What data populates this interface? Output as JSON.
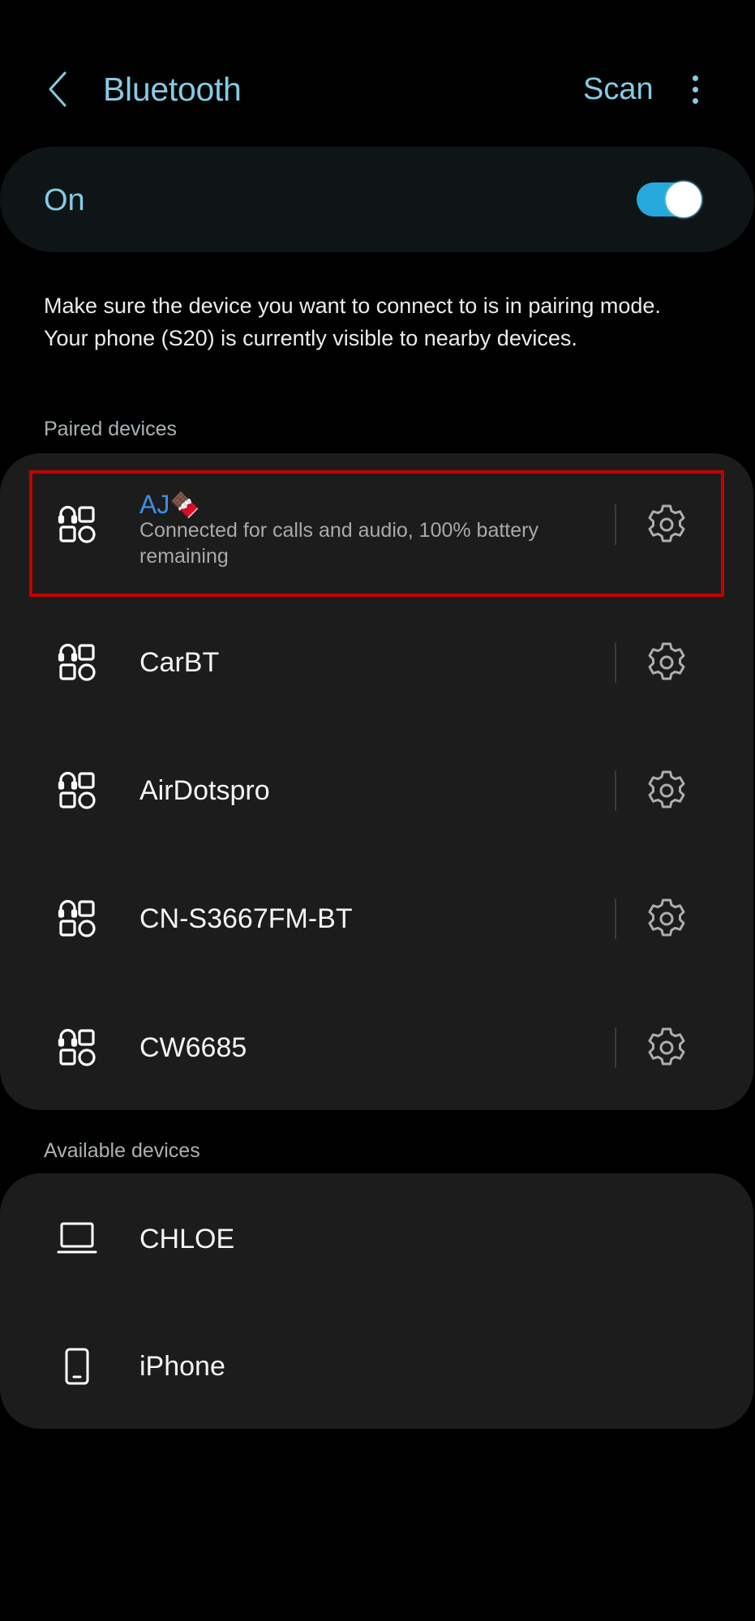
{
  "header": {
    "title": "Bluetooth",
    "back_icon": "chevron-left-icon",
    "scan_label": "Scan",
    "more_icon": "more-vertical-icon"
  },
  "master_switch": {
    "label": "On",
    "state": "on",
    "accent_color": "#27a8dc"
  },
  "description": {
    "line1": "Make sure the device you want to connect to is in pairing mode.",
    "line2": "Your phone (S20) is currently visible to nearby devices."
  },
  "paired": {
    "section_label": "Paired devices",
    "devices": [
      {
        "name": "AJ",
        "name_emoji": "🍫",
        "status": "Connected for calls and audio, 100% battery remaining",
        "connected": true,
        "icon": "audio-multi-device-icon",
        "settings_icon": "gear-icon",
        "name_color": "#3d8fe0"
      },
      {
        "name": "CarBT",
        "icon": "audio-multi-device-icon",
        "settings_icon": "gear-icon"
      },
      {
        "name": "AirDotspro",
        "icon": "audio-multi-device-icon",
        "settings_icon": "gear-icon"
      },
      {
        "name": "CN-S3667FM-BT",
        "icon": "audio-multi-device-icon",
        "settings_icon": "gear-icon"
      },
      {
        "name": "CW6685",
        "icon": "audio-multi-device-icon",
        "settings_icon": "gear-icon"
      }
    ]
  },
  "available": {
    "section_label": "Available devices",
    "devices": [
      {
        "name": "CHLOE",
        "icon": "laptop-icon"
      },
      {
        "name": "iPhone",
        "icon": "smartphone-icon"
      }
    ]
  },
  "highlight": {
    "target": "paired.devices.0",
    "color": "#c40000"
  }
}
